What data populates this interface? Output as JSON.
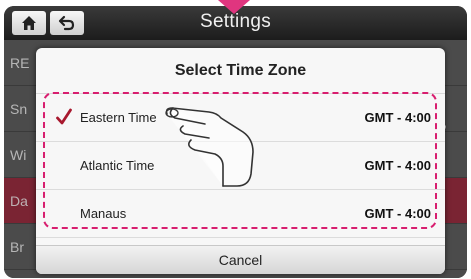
{
  "header": {
    "title": "Settings",
    "home_icon": "home-icon",
    "back_icon": "back-arrow-icon"
  },
  "background_list": {
    "items": [
      {
        "fragment": "RE"
      },
      {
        "fragment": "Sn"
      },
      {
        "fragment": "Wi"
      },
      {
        "fragment": "Da"
      },
      {
        "fragment": "Br"
      }
    ],
    "edge_mark": ","
  },
  "dialog": {
    "title": "Select Time Zone",
    "options": [
      {
        "name": "Eastern Time",
        "offset": "GMT - 4:00",
        "selected": true
      },
      {
        "name": "Atlantic Time",
        "offset": "GMT - 4:00",
        "selected": false
      },
      {
        "name": "Manaus",
        "offset": "GMT - 4:00",
        "selected": false
      }
    ],
    "cancel_label": "Cancel"
  },
  "colors": {
    "accent": "#d81e6f",
    "check": "#a8182e",
    "selected_row_bg": "#7a2433"
  }
}
